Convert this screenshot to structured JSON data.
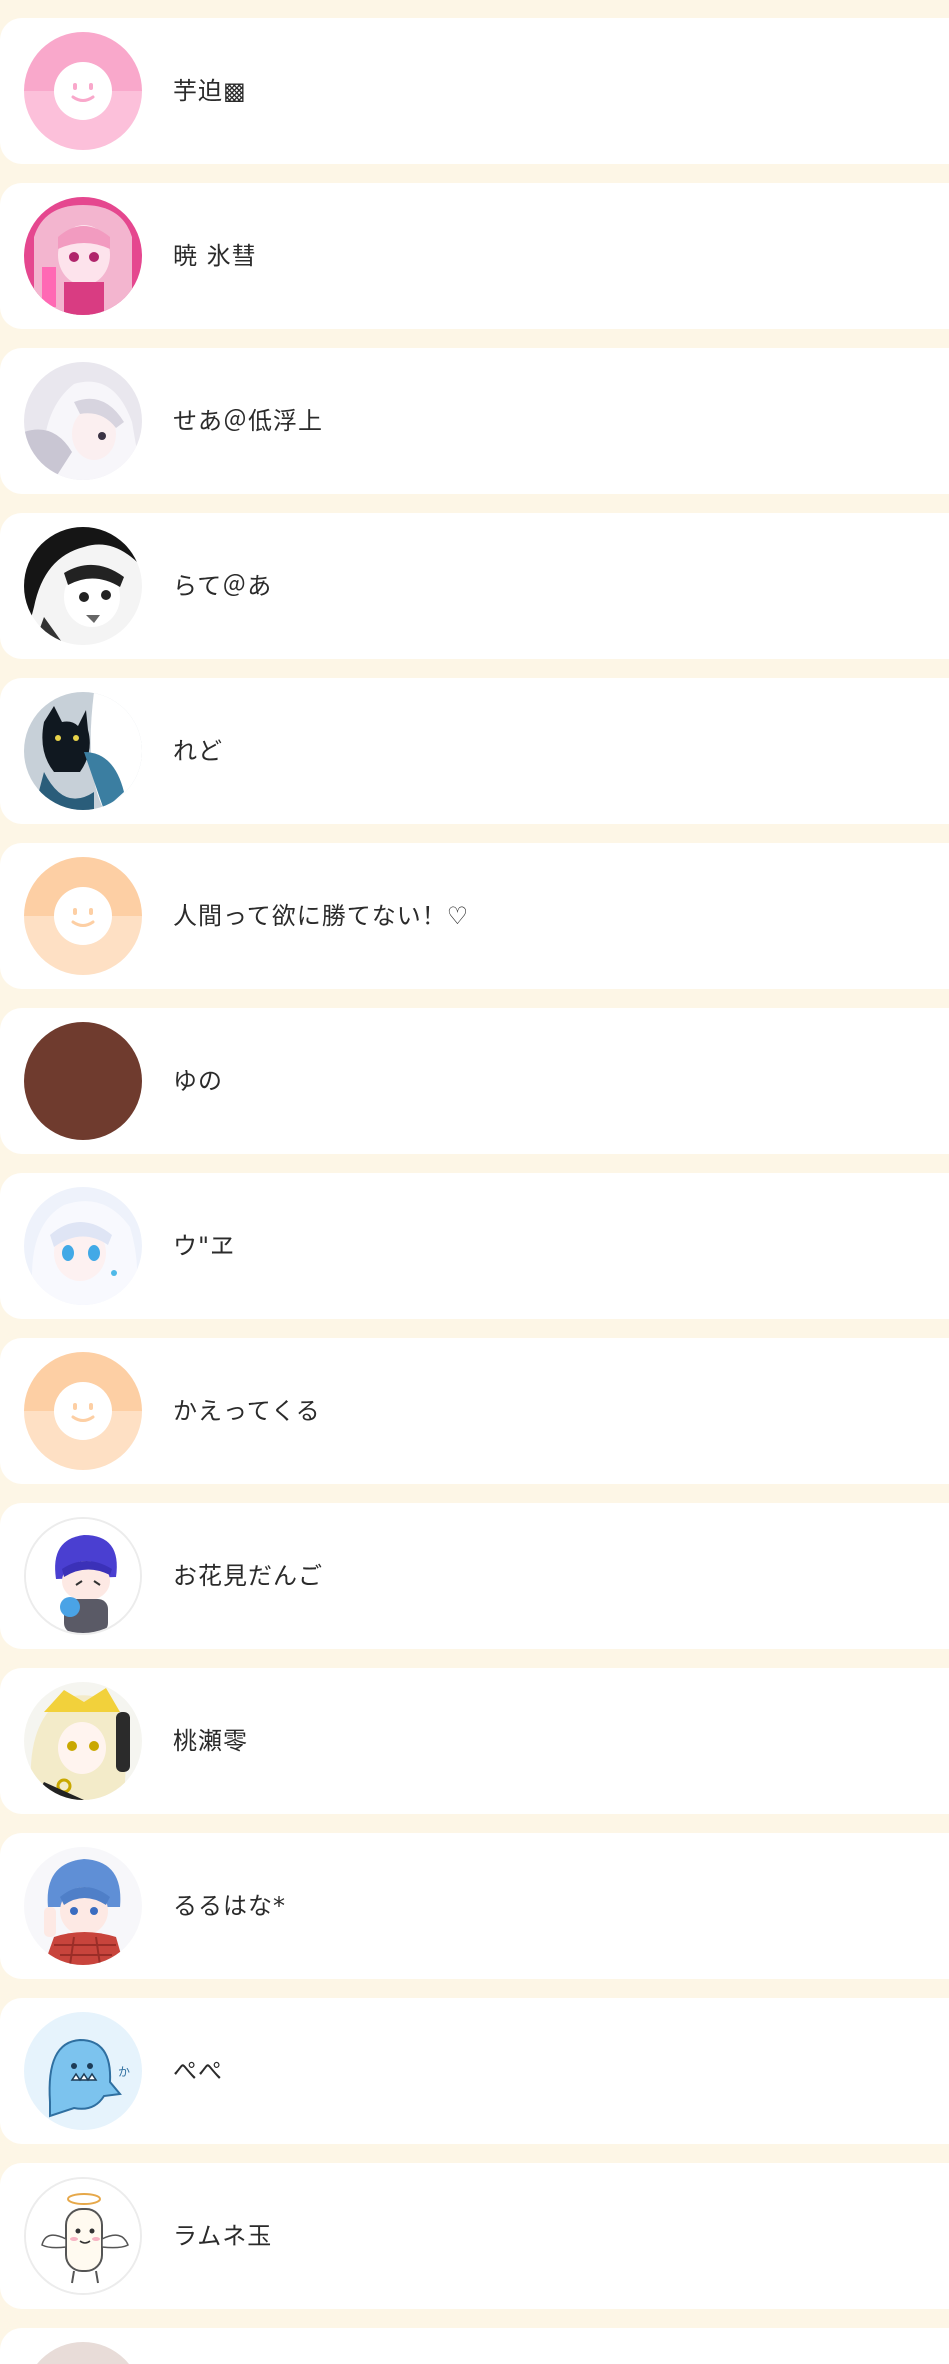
{
  "users": [
    {
      "name": "芋迫▩",
      "avatar": "default-face-pink"
    },
    {
      "name": "暁  氷彗",
      "avatar": "anime-girl-pink-portrait"
    },
    {
      "name": "せあ＠低浮上",
      "avatar": "anime-girl-white-hair-portrait"
    },
    {
      "name": "らて＠あ",
      "avatar": "monochrome-manga-portrait"
    },
    {
      "name": "れど",
      "avatar": "black-cat-illustration"
    },
    {
      "name": "人間って欲に勝てない！♡",
      "avatar": "default-face-peach"
    },
    {
      "name": "ゆの",
      "avatar": "solid-brown-circle"
    },
    {
      "name": "ウ\"ヱ",
      "avatar": "anime-girl-blue-eyes-portrait"
    },
    {
      "name": "かえってくる",
      "avatar": "default-face-peach"
    },
    {
      "name": "お花見だんご",
      "avatar": "chibi-blue-hair-character"
    },
    {
      "name": "桃瀬零",
      "avatar": "anime-blonde-headphones-portrait"
    },
    {
      "name": "るるはな*",
      "avatar": "anime-blue-hair-plaid-portrait"
    },
    {
      "name": "ぺぺ",
      "avatar": "blue-ghost-doodle"
    },
    {
      "name": "ラムネ玉",
      "avatar": "angel-doodle"
    }
  ],
  "colors": {
    "page_background": "#fdf6e6",
    "row_background": "#ffffff",
    "name_text": "#2b2b2b",
    "default_pink": "#f9a8cb",
    "default_peach": "#fdd0a6",
    "brown": "#6f3b2e"
  }
}
